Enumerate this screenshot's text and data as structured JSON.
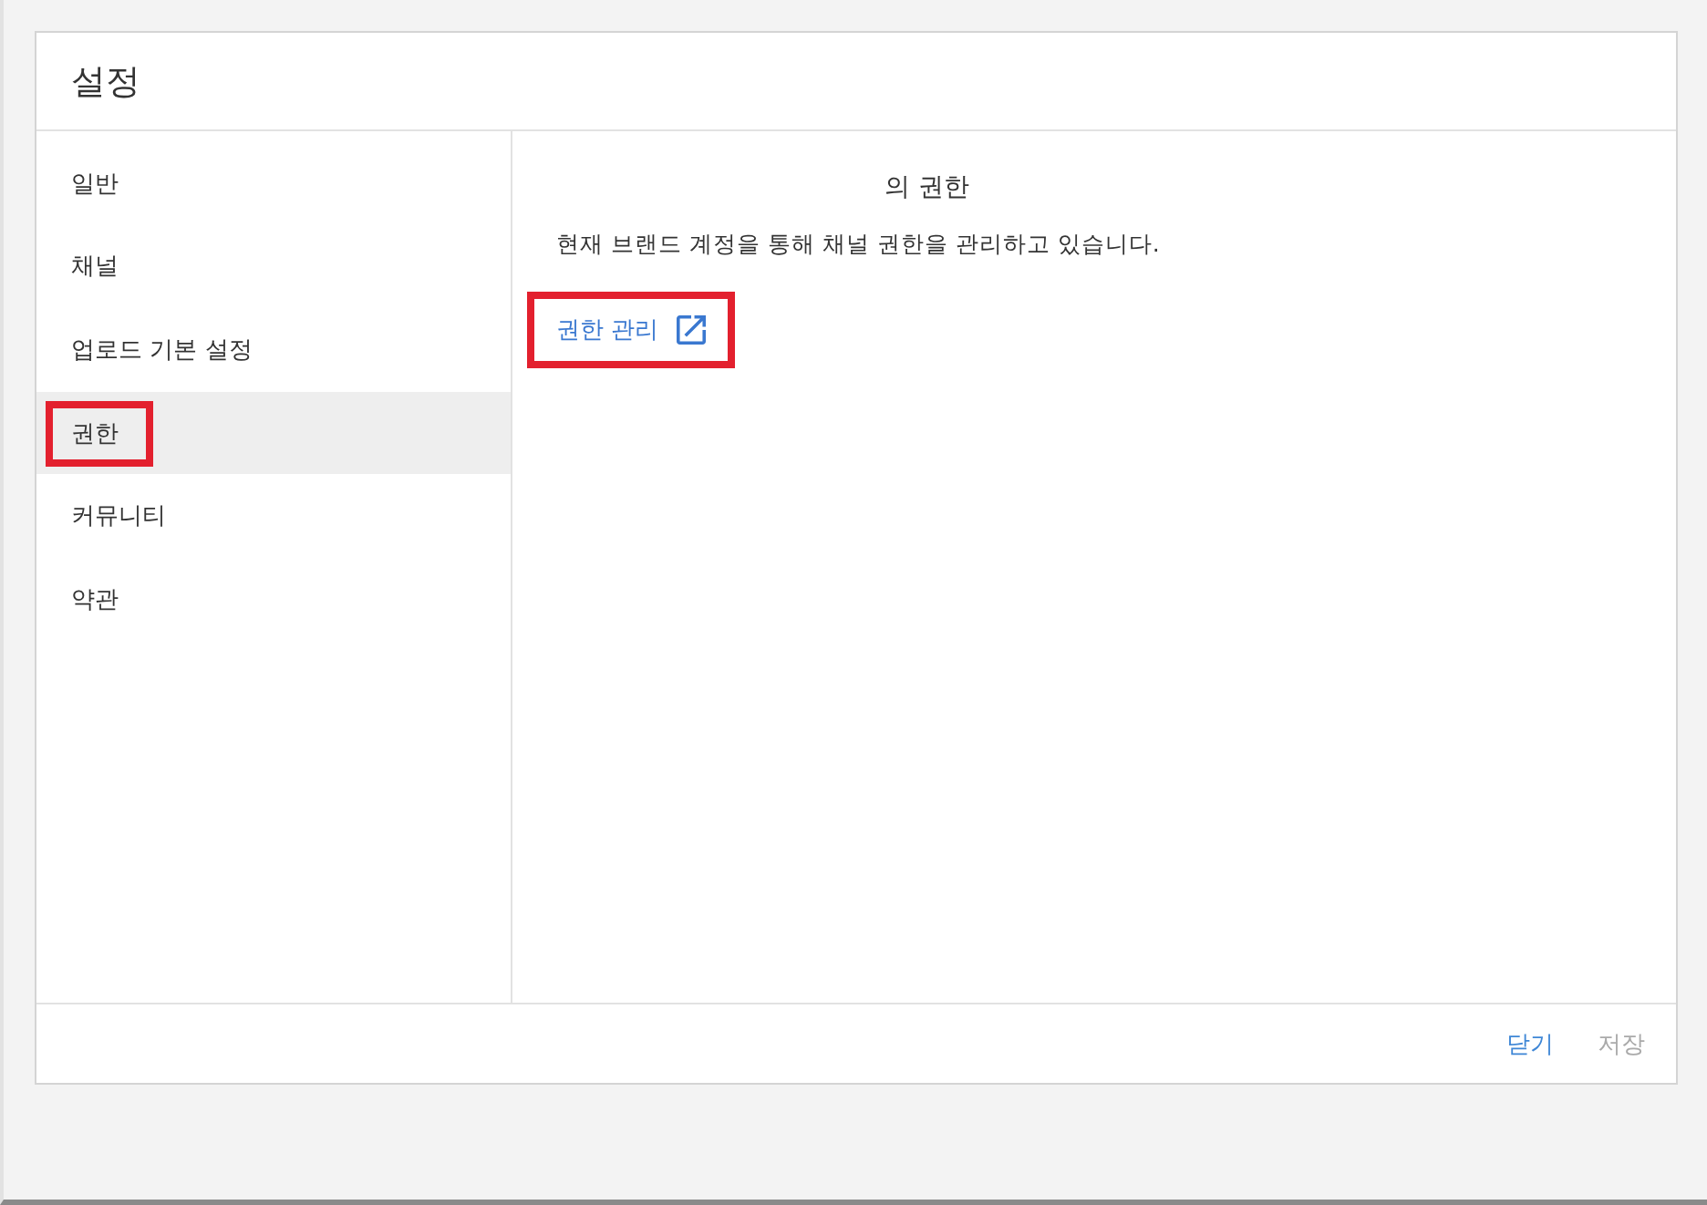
{
  "dialog": {
    "title": "설정"
  },
  "sidebar": {
    "items": [
      {
        "label": "일반",
        "selected": false,
        "annotated": false
      },
      {
        "label": "채널",
        "selected": false,
        "annotated": false
      },
      {
        "label": "업로드 기본 설정",
        "selected": false,
        "annotated": false
      },
      {
        "label": "권한",
        "selected": true,
        "annotated": true
      },
      {
        "label": "커뮤니티",
        "selected": false,
        "annotated": false
      },
      {
        "label": "약관",
        "selected": false,
        "annotated": false
      }
    ]
  },
  "content": {
    "heading": "의 권한",
    "description": "현재 브랜드 계정을 통해 채널 권한을 관리하고 있습니다.",
    "link": {
      "label": "권한 관리",
      "annotated": true
    }
  },
  "footer": {
    "buttons": [
      {
        "label": "닫기",
        "disabled": false
      },
      {
        "label": "저장",
        "disabled": true
      }
    ]
  }
}
